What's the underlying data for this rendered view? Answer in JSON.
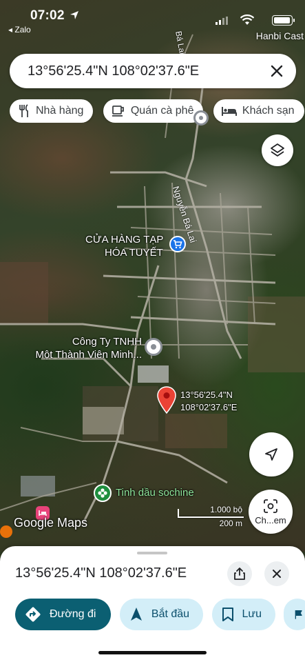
{
  "status_bar": {
    "time": "07:02",
    "back_app": "◂ Zalo",
    "corner_label": "Hanbi Cast"
  },
  "search": {
    "query": "13°56'25.4\"N 108°02'37.6\"E"
  },
  "chips": [
    {
      "label": "Nhà hàng",
      "icon": "restaurant-icon"
    },
    {
      "label": "Quán cà phê",
      "icon": "cafe-icon"
    },
    {
      "label": "Khách sạn",
      "icon": "hotel-icon"
    }
  ],
  "map": {
    "road_name": "Nguyễn Bá Lai",
    "road_name_top": "Bá Lai",
    "store_label_line1": "CỬA HÀNG TẠP",
    "store_label_line2": "HÓA TUYẾT",
    "company_label_line1": "Công Ty TNHH",
    "company_label_line2": "Một Thành Viên Minh...",
    "pin_coord_line1": "13°56'25.4\"N",
    "pin_coord_line2": "108°02'37.6\"E",
    "essential_oil_label": "Tinh dầu sochine",
    "google_logo": "Google Maps",
    "scale_top": "1.000 bộ",
    "scale_bottom": "200 m",
    "lens_label": "Ch...em"
  },
  "sheet": {
    "title": "13°56'25.4\"N 108°02'37.6\"E",
    "actions": [
      {
        "label": "Đường đi",
        "icon": "directions-icon"
      },
      {
        "label": "Bắt đầu",
        "icon": "navigation-icon"
      },
      {
        "label": "Lưu",
        "icon": "bookmark-icon"
      }
    ]
  },
  "colors": {
    "primary_action": "#0b5f72",
    "secondary_action": "#d3eef8",
    "pin": "#ea4335",
    "poi_shop": "#1a73e8",
    "poi_green": "#1e8e3e"
  }
}
